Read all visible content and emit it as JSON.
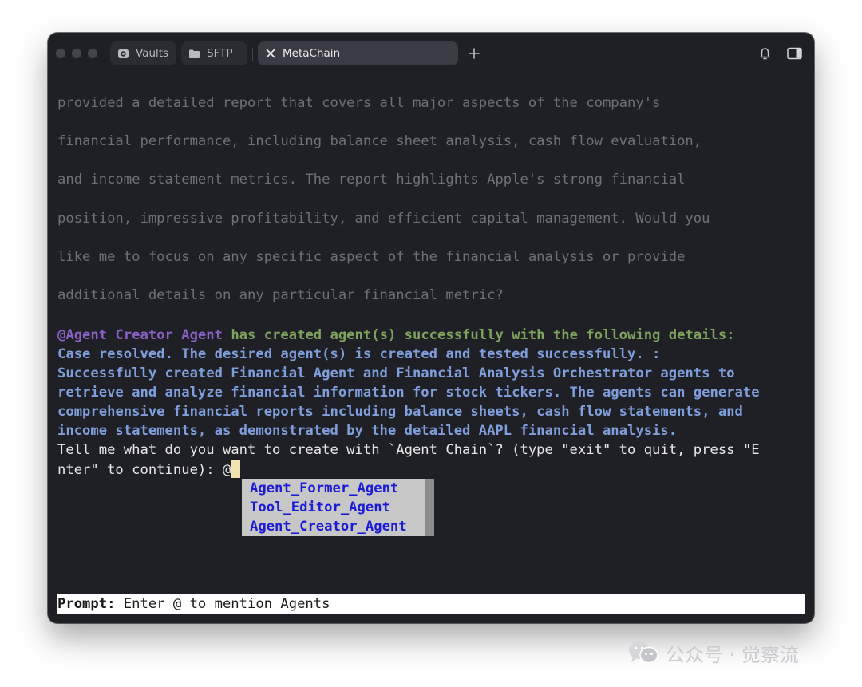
{
  "tabs": [
    {
      "label": "Vaults",
      "icon": "vault-icon"
    },
    {
      "label": "SFTP",
      "icon": "folder-icon"
    },
    {
      "label": "MetaChain",
      "icon": "close-icon",
      "active": true
    }
  ],
  "terminal": {
    "previous_output": [
      "provided a detailed report that covers all major aspects of the company's",
      "financial performance, including balance sheet analysis, cash flow evaluation,",
      "and income statement metrics. The report highlights Apple's strong financial",
      "position, impressive profitability, and efficient capital management. Would you",
      "like me to focus on any specific aspect of the financial analysis or provide",
      "additional details on any particular financial metric?"
    ],
    "agent_name": "@Agent Creator Agent",
    "agent_status": " has created agent(s) successfully with the following details:",
    "result_lines": [
      "Case resolved. The desired agent(s) is created and tested successfully. :",
      "Successfully created Financial Agent and Financial Analysis Orchestrator agents to",
      "retrieve and analyze financial information for stock tickers. The agents can generate",
      "comprehensive financial reports including balance sheets, cash flow statements, and",
      "income statements, as demonstrated by the detailed AAPL financial analysis."
    ],
    "question_line_1": "Tell me what do you want to create with `Agent Chain`? (type \"exit\" to quit, press \"E",
    "question_line_2": "nter\" to continue): @"
  },
  "autocomplete": {
    "options": [
      "Agent_Former_Agent",
      "Tool_Editor_Agent",
      "Agent_Creator_Agent"
    ]
  },
  "prompt": {
    "label": "Prompt:",
    "placeholder": " Enter @ to mention Agents"
  },
  "watermark": {
    "text": "公众号 · 觉察流"
  },
  "colors": {
    "background": "#1f2025",
    "faded_text": "#6f7177",
    "agent_purple": "#8a60c4",
    "status_green": "#7ea35c",
    "result_blue": "#7f9edc",
    "menu_text_blue": "#1b1bd6",
    "cursor": "#f2e2b0"
  }
}
